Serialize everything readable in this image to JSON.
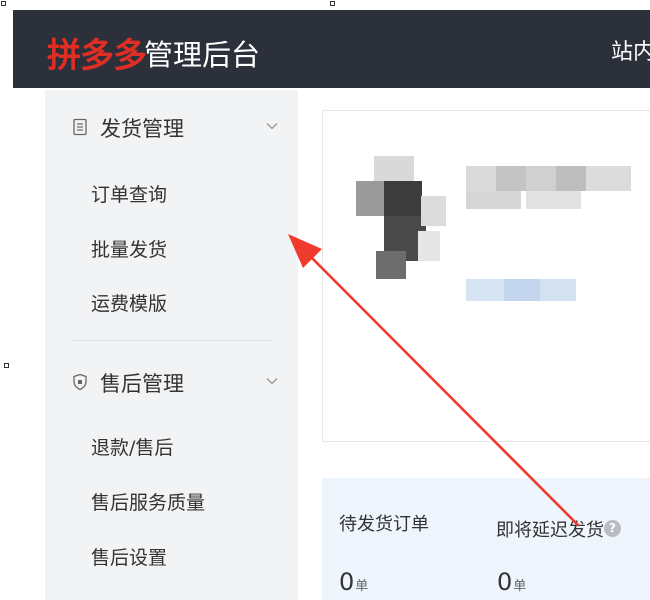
{
  "header": {
    "logo_brand": "拼多多",
    "logo_sub": "管理后台",
    "station_label": "站内"
  },
  "sidebar": {
    "sections": [
      {
        "label": "发货管理",
        "icon": "document-icon",
        "items": [
          "订单查询",
          "批量发货",
          "运费模版"
        ]
      },
      {
        "label": "售后管理",
        "icon": "shield-icon",
        "items": [
          "退款/售后",
          "售后服务质量",
          "售后设置"
        ]
      }
    ]
  },
  "stats": [
    {
      "label": "待发货订单",
      "value": "0",
      "unit": "单",
      "help": false
    },
    {
      "label": "即将延迟发货",
      "value": "0",
      "unit": "单",
      "help": true
    }
  ],
  "colors": {
    "topbar": "#2c303b",
    "brand": "#e02e24",
    "sidebar_bg": "#f2f3f5",
    "stats_bg": "#eef5fc",
    "annotation_arrow": "#f03a2e"
  }
}
